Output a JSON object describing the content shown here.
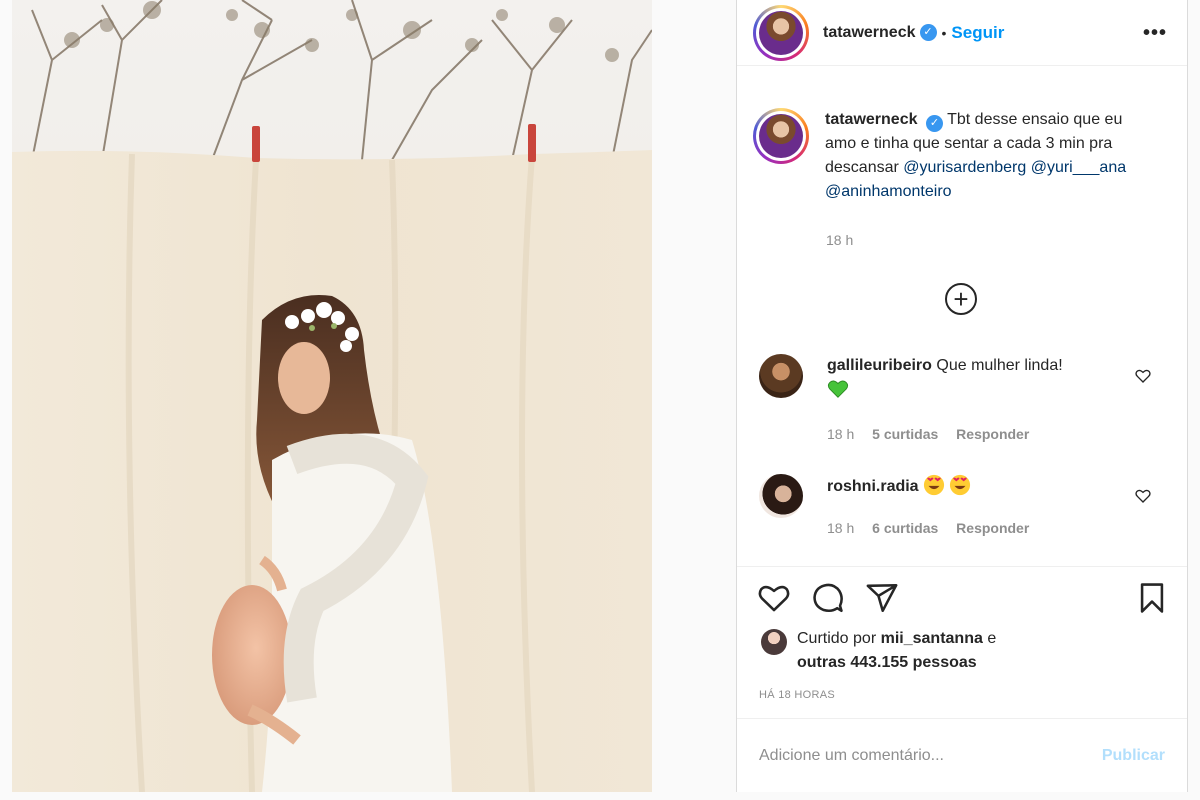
{
  "post": {
    "username": "tatawerneck",
    "follow_label": "Seguir",
    "separator": "•",
    "more_label": "•••",
    "verified_icon": "verified-badge-icon"
  },
  "caption": {
    "username": "tatawerneck",
    "text_before": "Tbt desse ensaio que eu amo e tinha que sentar a cada 3 min pra descansar",
    "mentions": [
      "@yurisardenberg",
      "@yuri___ana",
      "@aninhamonteiro"
    ],
    "time": "18 h"
  },
  "load_more_icon": "plus-circle-icon",
  "comments": [
    {
      "username": "gallileuribeiro",
      "text": "Que mulher linda!",
      "emoji": "green-heart-emoji",
      "time": "18 h",
      "likes": "5 curtidas",
      "reply": "Responder"
    },
    {
      "username": "roshni.radia",
      "text": "",
      "emoji": "heart-eyes-emoji",
      "time": "18 h",
      "likes": "6 curtidas",
      "reply": "Responder"
    }
  ],
  "actions": {
    "icons": [
      "heart-icon",
      "comment-icon",
      "share-icon",
      "bookmark-icon"
    ]
  },
  "likes": {
    "prefix": "Curtido por",
    "user": "mii_santanna",
    "joiner": "e",
    "others": "outras 443.155 pessoas"
  },
  "posted_ago": "HÁ 18 HORAS",
  "comment_box": {
    "placeholder": "Adicione um comentário...",
    "publish_label": "Publicar"
  },
  "colors": {
    "link": "#0095f6",
    "mention": "#00376b",
    "muted": "#8e8e8e",
    "publish_disabled": "#b2dffc"
  }
}
